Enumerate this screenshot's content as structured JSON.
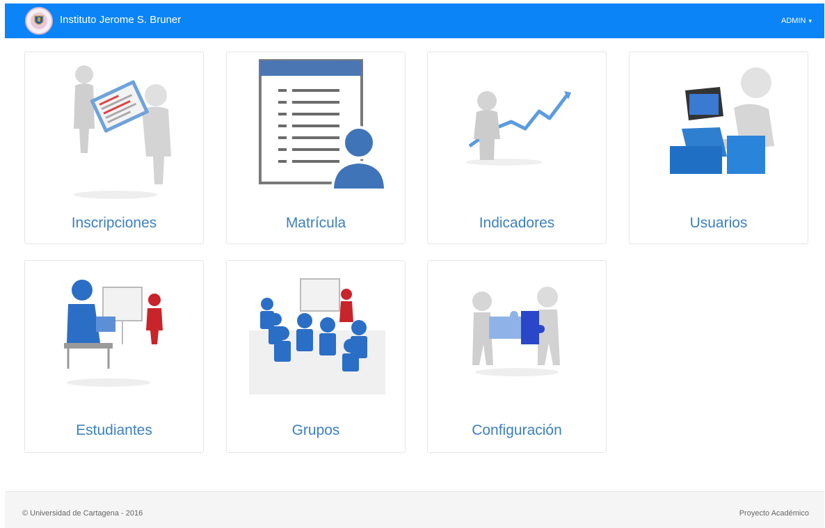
{
  "header": {
    "brand": "Instituto Jerome S. Bruner",
    "user_menu": "ADMIN",
    "caret": "▾",
    "logo_icon": "institute-seal-icon",
    "color": "#0a84f7"
  },
  "tiles": [
    {
      "label": "Inscripciones",
      "icon": "people-reviewing-form-icon"
    },
    {
      "label": "Matrícula",
      "icon": "enrollment-list-user-icon"
    },
    {
      "label": "Indicadores",
      "icon": "person-trend-chart-icon"
    },
    {
      "label": "Usuarios",
      "icon": "person-laptop-icon"
    },
    {
      "label": "Estudiantes",
      "icon": "student-teacher-board-icon"
    },
    {
      "label": "Grupos",
      "icon": "classroom-group-icon"
    },
    {
      "label": "Configuración",
      "icon": "puzzle-people-icon"
    }
  ],
  "footer": {
    "copyright": "© Universidad de Cartagena - 2016",
    "project": "Proyecto Académico"
  }
}
